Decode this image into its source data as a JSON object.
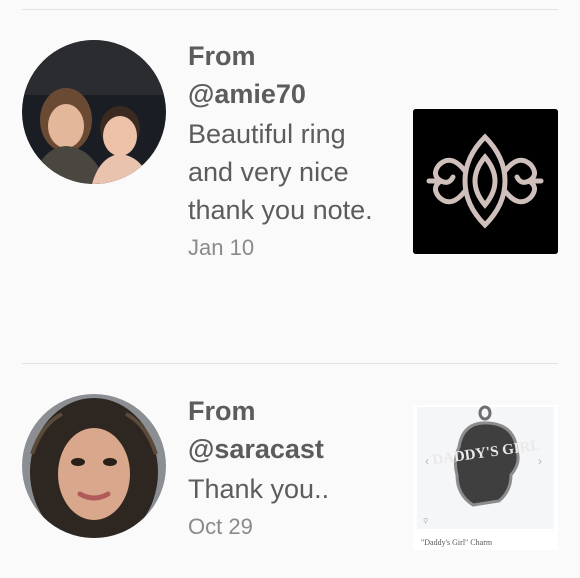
{
  "reviews": [
    {
      "from_label": "From",
      "username": "@amie70",
      "message": "Beautiful ring and very nice thank you note.",
      "date": "Jan 10",
      "avatar_icon": "user-photo-two-people",
      "thumbnail_icon": "silver-ring"
    },
    {
      "from_label": "From",
      "username": "@saracast",
      "message": "Thank you..",
      "date": "Oct 29",
      "avatar_icon": "user-photo-woman",
      "thumbnail_icon": "daddys-girl-charm",
      "thumbnail_art_text": "DADDY'S GIRL",
      "thumbnail_caption": "\"Daddy's Girl\" Charm"
    }
  ],
  "colors": {
    "background": "#fafafa",
    "divider": "#e3e3e3",
    "text": "#5c5c5c",
    "date": "#8a8a8a"
  }
}
